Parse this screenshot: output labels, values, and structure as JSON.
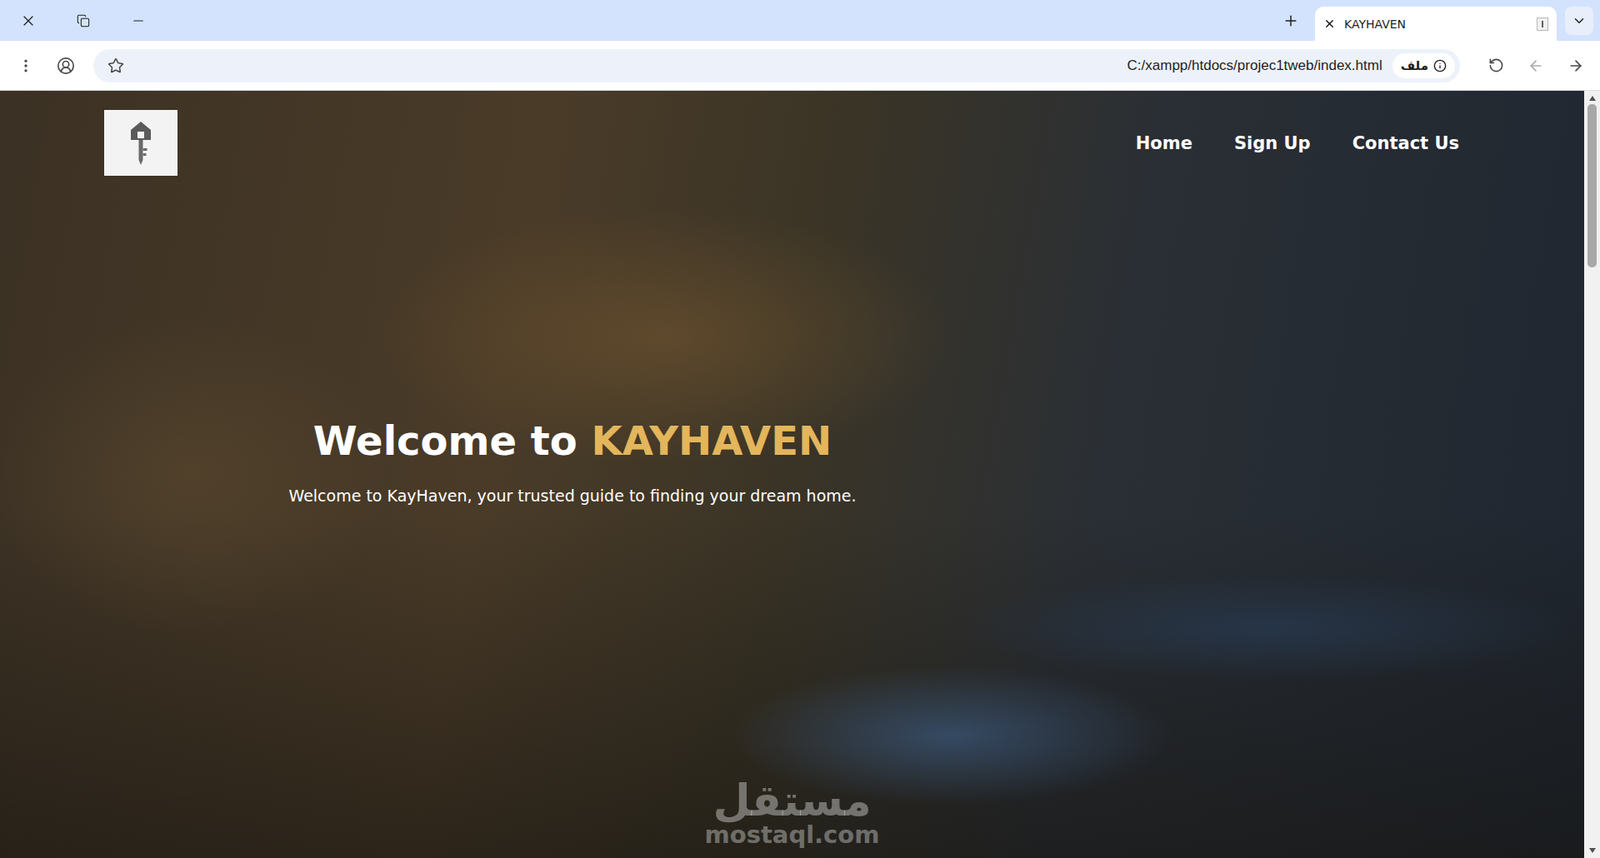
{
  "tabs": [
    {
      "label": "KAYHAVEN",
      "selected": true
    }
  ],
  "address_bar": {
    "chip": "ملف",
    "url": "C:/xampp/htdocs/projec1tweb/index.html"
  },
  "navigation": {
    "back_enabled": true,
    "forward_enabled": false
  },
  "page": {
    "nav": [
      {
        "label": "Home"
      },
      {
        "label": "Sign Up"
      },
      {
        "label": "Contact Us"
      }
    ],
    "hero": {
      "title": [
        {
          "text": "Welcome to ",
          "highlight": false
        },
        {
          "text": "KAYHAVEN",
          "highlight": true
        }
      ],
      "subtitle": "Welcome to KayHaven, your trusted guide to finding your dream home."
    }
  },
  "watermark": {
    "arabic": "مستقل",
    "latin": "mostaql.com"
  },
  "scrollbar": {
    "level": 0.22
  }
}
